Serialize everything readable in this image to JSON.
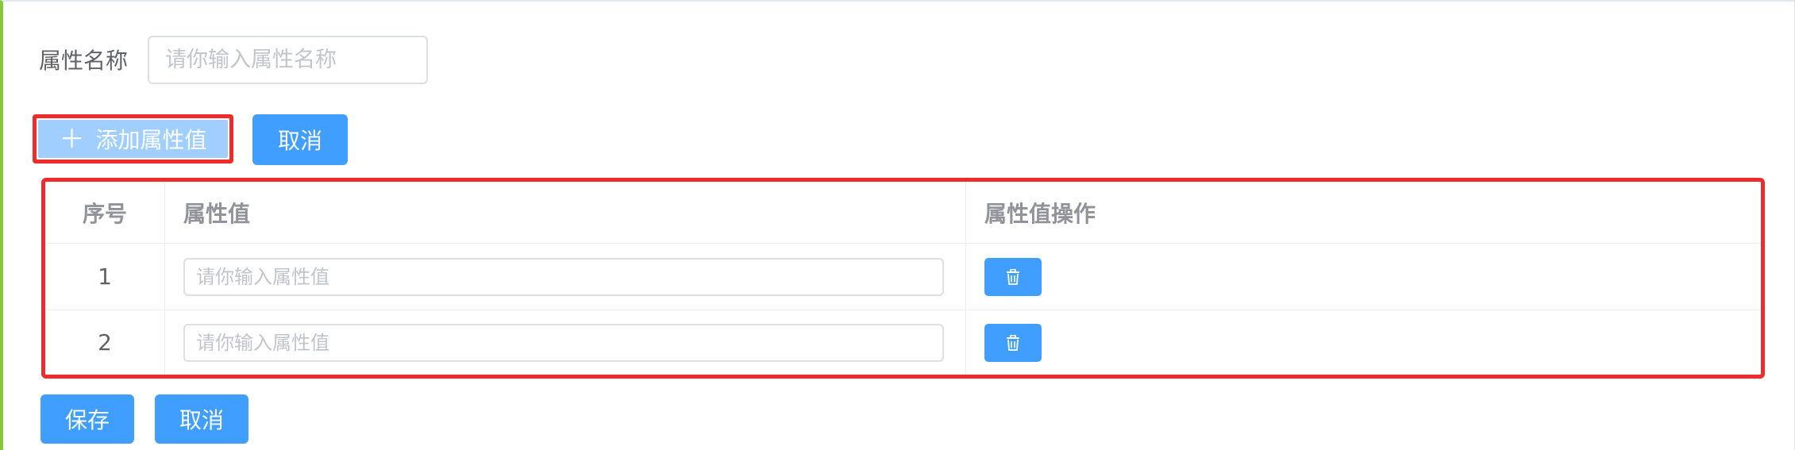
{
  "form": {
    "attr_name_label": "属性名称",
    "attr_name_placeholder": "请你输入属性名称",
    "attr_name_value": ""
  },
  "toolbar": {
    "add_icon": "plus-icon",
    "add_label": "添加属性值",
    "cancel_label": "取消"
  },
  "table": {
    "columns": [
      "序号",
      "属性值",
      "属性值操作"
    ],
    "rows": [
      {
        "index": "1",
        "value": "",
        "placeholder": "请你输入属性值",
        "action_icon": "trash-icon"
      },
      {
        "index": "2",
        "value": "",
        "placeholder": "请你输入属性值",
        "action_icon": "trash-icon"
      }
    ]
  },
  "footer": {
    "save_label": "保存",
    "cancel_label": "取消"
  },
  "colors": {
    "primary": "#409eff",
    "primary_disabled": "#a0cfff",
    "highlight": "#ef2b2b",
    "accent_bar": "#8cc63f"
  }
}
